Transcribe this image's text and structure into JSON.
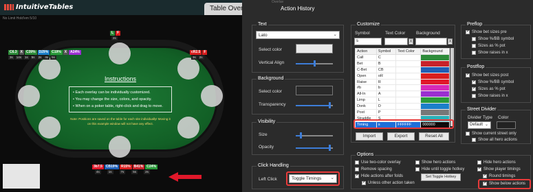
{
  "left": {
    "logo": "IntuitiveTables",
    "table_tab": "Table Overl",
    "subtitle": "No Limit Hold'em 5/10",
    "seat_top_labels": [
      "L",
      "F"
    ],
    "seat_top_count": "2s",
    "hud_left": [
      "C6.3",
      "X",
      "C39%",
      "D29%",
      "C19%",
      "X",
      "A24%"
    ],
    "hud_left_row2": [
      "3s",
      "14s",
      "1s",
      "5s",
      "2s",
      "4s",
      "5s"
    ],
    "hud_right": [
      "cR2.5",
      "F"
    ],
    "hud_right_row2": [
      "3s",
      "2s"
    ],
    "hud_bottom": [
      "3b7.5",
      "CB19%",
      "R15%",
      "B41%",
      "C24%"
    ],
    "hud_bottom_row2": [
      "4s",
      "1s",
      "7s",
      "5s",
      "2s"
    ],
    "instructions_title": "Instructions",
    "instructions": [
      "Each overlay can be individually customized.",
      "You may change the size, colors, and opacity.",
      "When on a poker table, right-click and drag to move."
    ],
    "note": "Note: Positions are saved on the table for each site individually! Moving it on this example window will not have any effect."
  },
  "right": {
    "overlay_small_label": "Overlay",
    "panel_title": "Action History",
    "text_group": {
      "label": "Text",
      "font": "Lato",
      "select_color": "Select color",
      "vertical_align": "Vertical Align"
    },
    "background_group": {
      "label": "Background",
      "select_color": "Select color",
      "transparency": "Transparency"
    },
    "visibility_group": {
      "label": "Visibility",
      "size": "Size",
      "opacity": "Opacity"
    },
    "click_group": {
      "label": "Click Handling",
      "left_click": "Left Click",
      "left_click_value": "Toggle Timings"
    },
    "customize": {
      "label": "Customize",
      "col_symbol": "Symbol",
      "col_text_color": "Text Color",
      "col_background": "Background",
      "symbol_value": "s",
      "table_headers": [
        "Action",
        "Symbol",
        "Text Color",
        "Background"
      ],
      "rows": [
        {
          "action": "Call",
          "symbol": "C",
          "bg": "#2e8b3a"
        },
        {
          "action": "Bet",
          "symbol": "B",
          "bg": "#c8222a"
        },
        {
          "action": "C-Bet",
          "symbol": "CB",
          "bg": "#1f5fb5"
        },
        {
          "action": "Open",
          "symbol": "oR",
          "bg": "#d91e1e"
        },
        {
          "action": "Raise",
          "symbol": "R",
          "bg": "#e0182a"
        },
        {
          "action": "#b",
          "symbol": "b",
          "bg": "#d62ab8"
        },
        {
          "action": "All-In",
          "symbol": "A",
          "bg": "#9b2fd1"
        },
        {
          "action": "Limp",
          "symbol": "L",
          "bg": "#2a9a3a"
        },
        {
          "action": "Donk",
          "symbol": "D",
          "bg": "#1c7fc9"
        },
        {
          "action": "Post",
          "symbol": "P",
          "bg": "#777777"
        },
        {
          "action": "Straddle",
          "symbol": "S",
          "bg": "#2bb0b8"
        }
      ],
      "timing_row": {
        "action": "Timing",
        "symbol": "s",
        "text_color": "FFFFFF",
        "background": "000000"
      },
      "import": "Import",
      "export": "Export",
      "reset": "Reset All"
    },
    "preflop": {
      "label": "Preflop",
      "items": [
        "Show bet sizes pre",
        "Show %/BB symbol",
        "Sizes as % pot",
        "Show raises in x"
      ]
    },
    "postflop": {
      "label": "Postflop",
      "items": [
        "Show bet sizes post",
        "Show %/BB symbol",
        "Sizes as % pot",
        "Show raises in x"
      ]
    },
    "street": {
      "label": "Street Divider",
      "divider_type": "Divider Type",
      "color": "Color",
      "divider_value": "Default",
      "current_only": "Show current street only",
      "all_hero": "Show all hero actions"
    },
    "options": {
      "label": "Options",
      "col1": [
        "Use two-color overlay",
        "Remove spacing",
        "Hide actions after folds",
        "Unless other action taken"
      ],
      "col2": [
        "Show hero actions",
        "Hide until toggle hotkey",
        "Set Toggle Hotkey"
      ],
      "col3": [
        "Hide hero actions",
        "Show player timings",
        "Round timings",
        "Show below actions"
      ]
    }
  },
  "colors": {
    "accent": "#3d7dd8",
    "highlight": "#e83a3a",
    "felt": "#126026"
  }
}
